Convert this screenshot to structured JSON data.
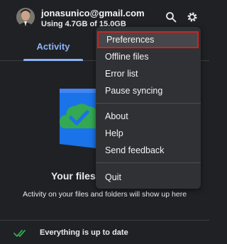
{
  "account": {
    "email": "jonasunico@gmail.com",
    "usage": "Using 4.7GB of 15.0GB"
  },
  "header_icons": [
    "search-icon",
    "gear-icon"
  ],
  "tabs": [
    {
      "label": "Activity",
      "active": true
    }
  ],
  "activity": {
    "empty_title": "Your files a",
    "empty_description": "Activity on your files and folders will show up here"
  },
  "status": {
    "text": "Everything is up to date",
    "icon": "double-check-icon"
  },
  "menu": {
    "items": [
      {
        "label": "Preferences",
        "highlighted": true
      },
      {
        "label": "Offline files"
      },
      {
        "label": "Error list"
      },
      {
        "label": "Pause syncing"
      },
      {
        "label": "About"
      },
      {
        "label": "Help"
      },
      {
        "label": "Send feedback"
      },
      {
        "label": "Quit"
      }
    ]
  },
  "colors": {
    "background": "#202124",
    "accent": "#8ab4f8",
    "menu_bg": "#303134",
    "highlight_border": "#d62020",
    "status_check": "#34a853"
  }
}
